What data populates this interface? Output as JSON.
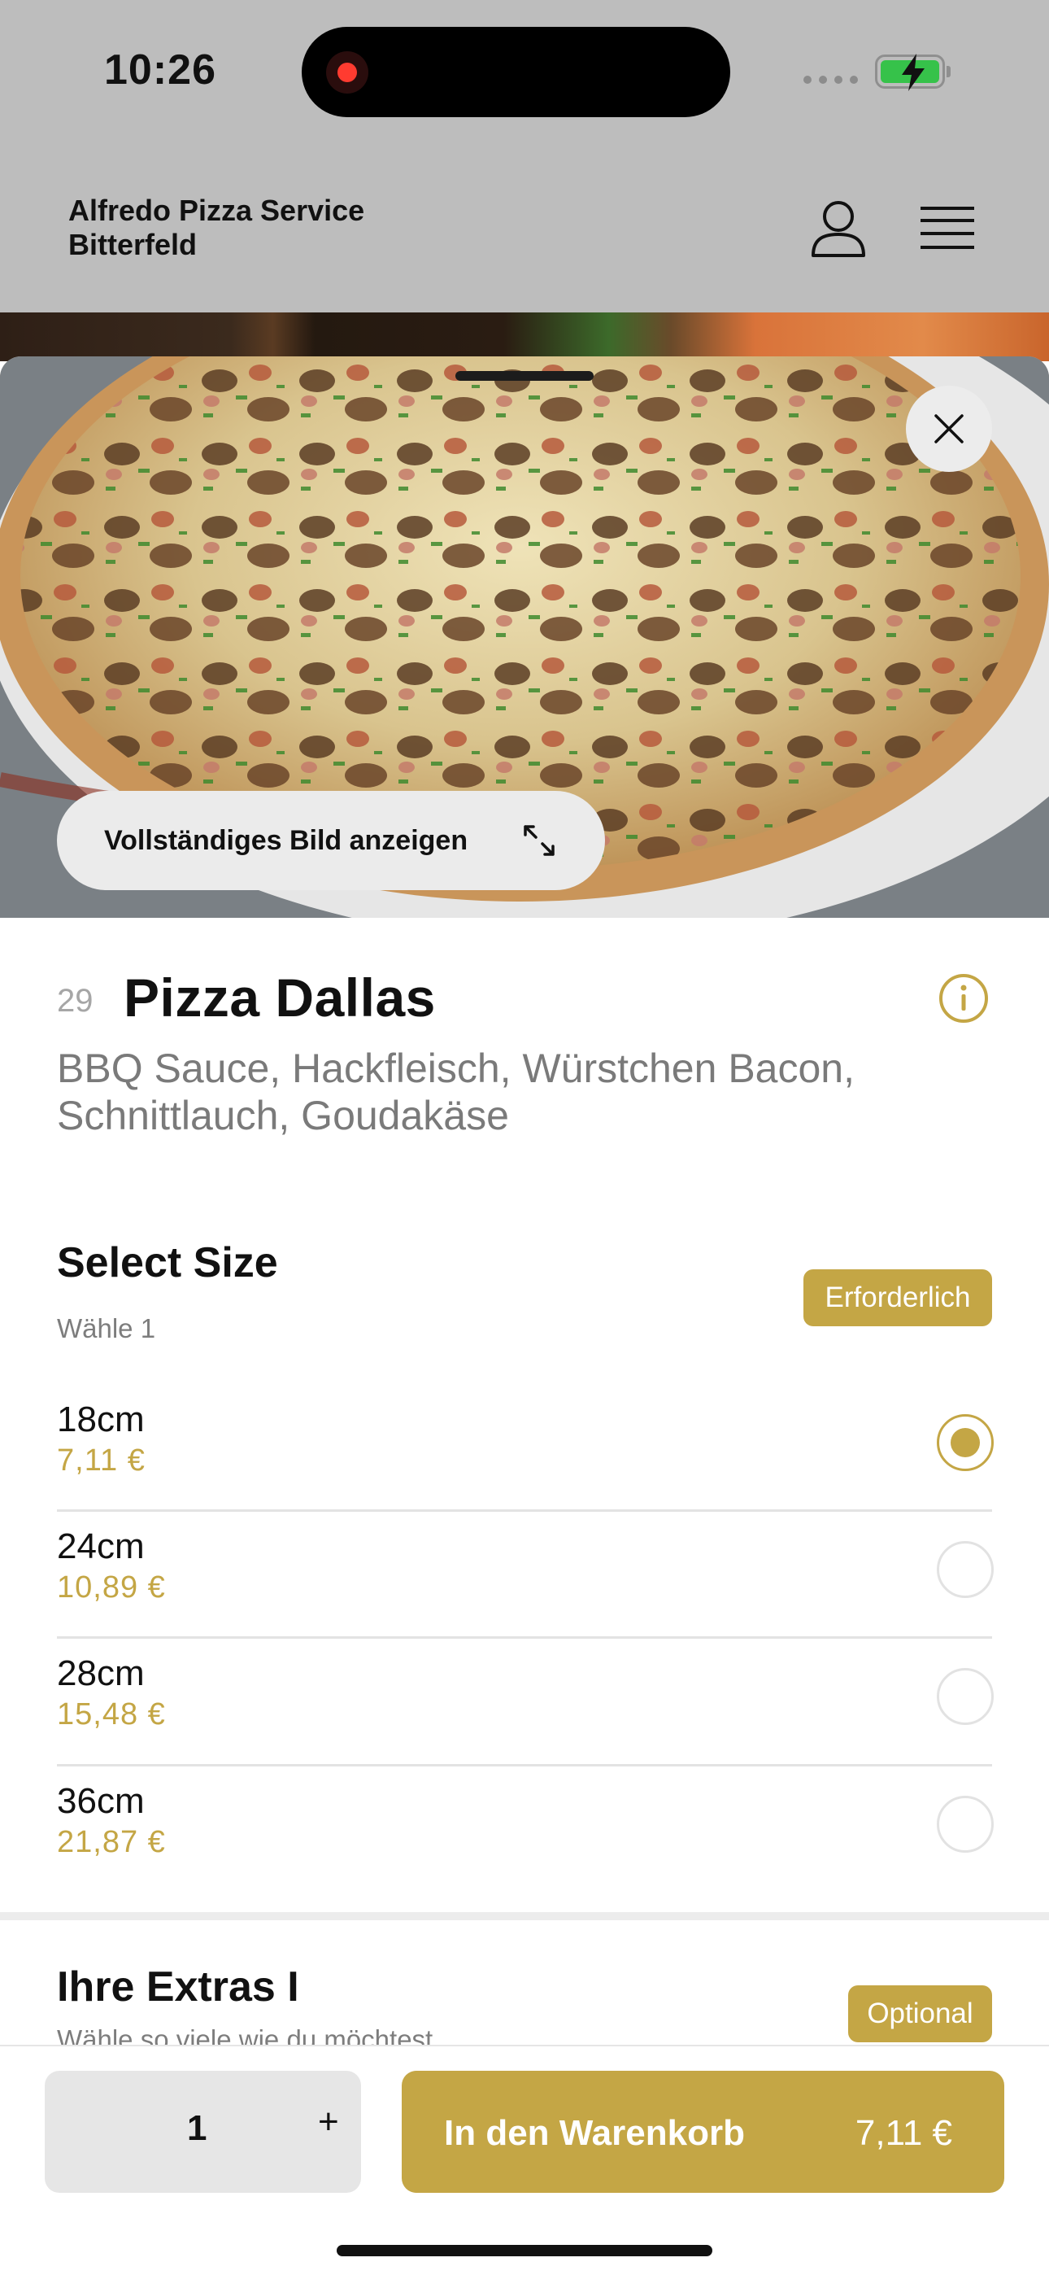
{
  "status_bar": {
    "time": "10:26"
  },
  "header": {
    "shop_name": "Alfredo Pizza Service Bitterfeld"
  },
  "photo": {
    "full_image_label": "Vollständiges Bild anzeigen"
  },
  "item": {
    "number": "29",
    "title": "Pizza Dallas",
    "description": "BBQ Sauce, Hackfleisch, Würstchen Bacon, Schnittlauch, Goudakäse"
  },
  "size_section": {
    "title": "Select Size",
    "subtitle": "Wähle 1",
    "badge": "Erforderlich",
    "options": [
      {
        "size": "18cm",
        "price": "7,11 €",
        "selected": true
      },
      {
        "size": "24cm",
        "price": "10,89 €",
        "selected": false
      },
      {
        "size": "28cm",
        "price": "15,48 €",
        "selected": false
      },
      {
        "size": "36cm",
        "price": "21,87 €",
        "selected": false
      }
    ]
  },
  "extras_section": {
    "title": "Ihre Extras I",
    "subtitle": "Wähle so viele wie du möchtest",
    "badge": "Optional"
  },
  "bottom_bar": {
    "quantity": "1",
    "plus": "+",
    "cart_label": "In den Warenkorb",
    "cart_price": "7,11 €"
  },
  "colors": {
    "accent": "#c4a645",
    "header_bg": "#bdbdbd",
    "qty_bg": "#e6e6e6",
    "battery": "#36c24a",
    "record": "#ff3b30"
  },
  "icons": [
    "record-icon",
    "battery-icon",
    "user-icon",
    "menu-icon",
    "close-icon",
    "expand-icon",
    "info-icon",
    "radio-icon"
  ]
}
